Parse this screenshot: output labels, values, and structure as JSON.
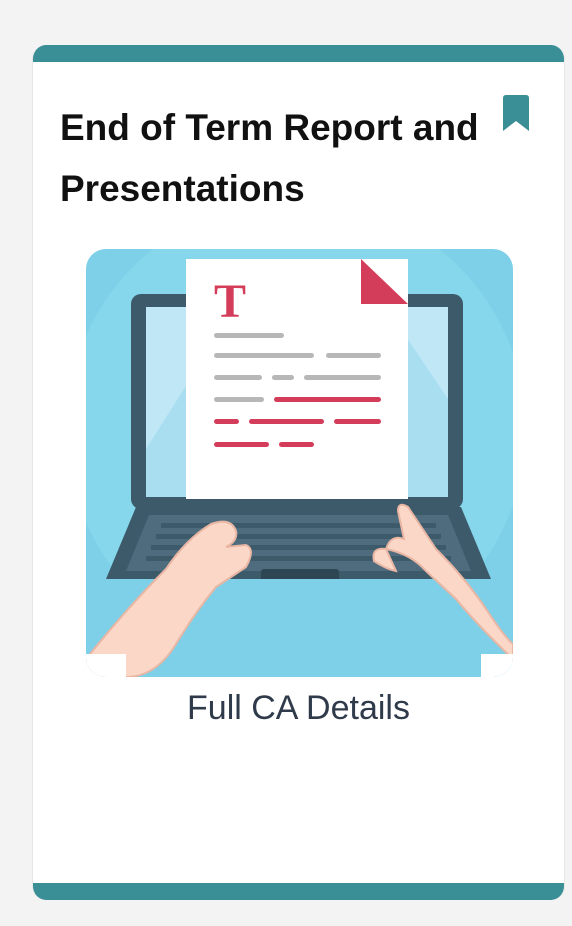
{
  "card": {
    "title": "End of Term Report and Presentations",
    "link_label": "Full CA Details",
    "document_letter": "T"
  },
  "icons": {
    "bookmark": "bookmark-icon"
  },
  "colors": {
    "accent": "#3a8f96",
    "doc_red": "#d43d5a",
    "illustration_bg": "#7ed0e8"
  }
}
